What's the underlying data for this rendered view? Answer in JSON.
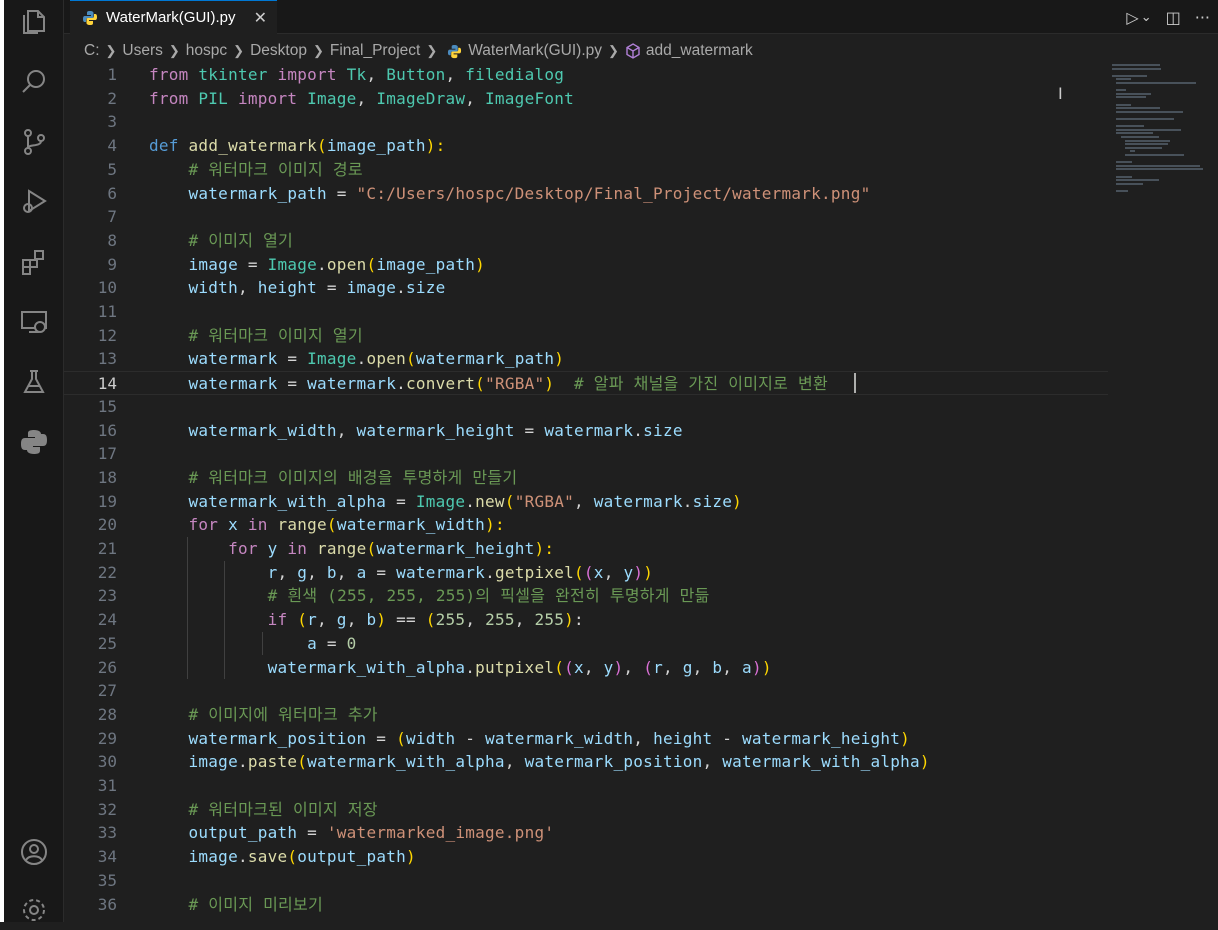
{
  "window": {
    "tab_title": "WaterMark(GUI).py",
    "tab_close": "✕",
    "run_button": "▷",
    "run_dropdown": "⌄",
    "split_button": "◫",
    "more_button": "···"
  },
  "breadcrumb": [
    "C:",
    "Users",
    "hospc",
    "Desktop",
    "Final_Project",
    "WaterMark(GUI).py",
    "add_watermark"
  ],
  "activity_bar": [
    "files-icon",
    "search-icon",
    "source-control-icon",
    "run-debug-icon",
    "extensions-icon",
    "remote-explorer-icon",
    "testing-icon",
    "python-icon",
    "account-icon",
    "settings-gear-icon"
  ],
  "editor": {
    "current_line": 14,
    "lines": [
      {
        "n": "1",
        "t": [
          [
            "from",
            "k"
          ],
          [
            " tkinter ",
            "c"
          ],
          [
            "import",
            "k"
          ],
          [
            " Tk",
            "c"
          ],
          [
            ", ",
            "o"
          ],
          [
            "Button",
            "c"
          ],
          [
            ", ",
            "o"
          ],
          [
            "filedialog",
            "c"
          ]
        ]
      },
      {
        "n": "2",
        "t": [
          [
            "from",
            "k"
          ],
          [
            " PIL ",
            "c"
          ],
          [
            "import",
            "k"
          ],
          [
            " Image",
            "c"
          ],
          [
            ", ",
            "o"
          ],
          [
            "ImageDraw",
            "c"
          ],
          [
            ", ",
            "o"
          ],
          [
            "ImageFont",
            "c"
          ]
        ]
      },
      {
        "n": "3",
        "t": []
      },
      {
        "n": "4",
        "t": [
          [
            "def",
            "d"
          ],
          [
            " ",
            "o"
          ],
          [
            "add_watermark",
            "f"
          ],
          [
            "(",
            "p1"
          ],
          [
            "image_path",
            "v"
          ],
          [
            "):",
            "p1"
          ]
        ]
      },
      {
        "n": "5",
        "t": [
          [
            "    ",
            "o"
          ],
          [
            "# 워터마크 이미지 경로",
            "m"
          ]
        ]
      },
      {
        "n": "6",
        "t": [
          [
            "    ",
            "o"
          ],
          [
            "watermark_path",
            "v"
          ],
          [
            " = ",
            "o"
          ],
          [
            "\"C:/Users/hospc/Desktop/Final_Project/watermark.png\"",
            "s"
          ]
        ]
      },
      {
        "n": "7",
        "t": []
      },
      {
        "n": "8",
        "t": [
          [
            "    ",
            "o"
          ],
          [
            "# 이미지 열기",
            "m"
          ]
        ]
      },
      {
        "n": "9",
        "t": [
          [
            "    ",
            "o"
          ],
          [
            "image",
            "v"
          ],
          [
            " = ",
            "o"
          ],
          [
            "Image",
            "c"
          ],
          [
            ".",
            "o"
          ],
          [
            "open",
            "f"
          ],
          [
            "(",
            "p1"
          ],
          [
            "image_path",
            "v"
          ],
          [
            ")",
            "p1"
          ]
        ]
      },
      {
        "n": "10",
        "t": [
          [
            "    ",
            "o"
          ],
          [
            "width",
            "v"
          ],
          [
            ", ",
            "o"
          ],
          [
            "height",
            "v"
          ],
          [
            " = ",
            "o"
          ],
          [
            "image",
            "v"
          ],
          [
            ".",
            "o"
          ],
          [
            "size",
            "v"
          ]
        ]
      },
      {
        "n": "11",
        "t": []
      },
      {
        "n": "12",
        "t": [
          [
            "    ",
            "o"
          ],
          [
            "# 워터마크 이미지 열기",
            "m"
          ]
        ]
      },
      {
        "n": "13",
        "t": [
          [
            "    ",
            "o"
          ],
          [
            "watermark",
            "v"
          ],
          [
            " = ",
            "o"
          ],
          [
            "Image",
            "c"
          ],
          [
            ".",
            "o"
          ],
          [
            "open",
            "f"
          ],
          [
            "(",
            "p1"
          ],
          [
            "watermark_path",
            "v"
          ],
          [
            ")",
            "p1"
          ]
        ]
      },
      {
        "n": "14",
        "t": [
          [
            "    ",
            "o"
          ],
          [
            "watermark",
            "v"
          ],
          [
            " = ",
            "o"
          ],
          [
            "watermark",
            "v"
          ],
          [
            ".",
            "o"
          ],
          [
            "convert",
            "f"
          ],
          [
            "(",
            "p1"
          ],
          [
            "\"RGBA\"",
            "s"
          ],
          [
            ")",
            "p1"
          ],
          [
            "  ",
            "o"
          ],
          [
            "# 알파 채널을 가진 이미지로 변환",
            "m"
          ]
        ]
      },
      {
        "n": "15",
        "t": []
      },
      {
        "n": "16",
        "t": [
          [
            "    ",
            "o"
          ],
          [
            "watermark_width",
            "v"
          ],
          [
            ", ",
            "o"
          ],
          [
            "watermark_height",
            "v"
          ],
          [
            " = ",
            "o"
          ],
          [
            "watermark",
            "v"
          ],
          [
            ".",
            "o"
          ],
          [
            "size",
            "v"
          ]
        ]
      },
      {
        "n": "17",
        "t": []
      },
      {
        "n": "18",
        "t": [
          [
            "    ",
            "o"
          ],
          [
            "# 워터마크 이미지의 배경을 투명하게 만들기",
            "m"
          ]
        ]
      },
      {
        "n": "19",
        "t": [
          [
            "    ",
            "o"
          ],
          [
            "watermark_with_alpha",
            "v"
          ],
          [
            " = ",
            "o"
          ],
          [
            "Image",
            "c"
          ],
          [
            ".",
            "o"
          ],
          [
            "new",
            "f"
          ],
          [
            "(",
            "p1"
          ],
          [
            "\"RGBA\"",
            "s"
          ],
          [
            ", ",
            "o"
          ],
          [
            "watermark",
            "v"
          ],
          [
            ".",
            "o"
          ],
          [
            "size",
            "v"
          ],
          [
            ")",
            "p1"
          ]
        ]
      },
      {
        "n": "20",
        "t": [
          [
            "    ",
            "o"
          ],
          [
            "for",
            "k"
          ],
          [
            " x ",
            "v"
          ],
          [
            "in",
            "k"
          ],
          [
            " ",
            "o"
          ],
          [
            "range",
            "f"
          ],
          [
            "(",
            "p1"
          ],
          [
            "watermark_width",
            "v"
          ],
          [
            "):",
            "p1"
          ]
        ]
      },
      {
        "n": "21",
        "t": [
          [
            "        ",
            "o"
          ],
          [
            "for",
            "k"
          ],
          [
            " y ",
            "v"
          ],
          [
            "in",
            "k"
          ],
          [
            " ",
            "o"
          ],
          [
            "range",
            "f"
          ],
          [
            "(",
            "p1"
          ],
          [
            "watermark_height",
            "v"
          ],
          [
            "):",
            "p1"
          ]
        ]
      },
      {
        "n": "22",
        "t": [
          [
            "            ",
            "o"
          ],
          [
            "r",
            "v"
          ],
          [
            ", ",
            "o"
          ],
          [
            "g",
            "v"
          ],
          [
            ", ",
            "o"
          ],
          [
            "b",
            "v"
          ],
          [
            ", ",
            "o"
          ],
          [
            "a",
            "v"
          ],
          [
            " = ",
            "o"
          ],
          [
            "watermark",
            "v"
          ],
          [
            ".",
            "o"
          ],
          [
            "getpixel",
            "f"
          ],
          [
            "(",
            "p1"
          ],
          [
            "(",
            "p2"
          ],
          [
            "x",
            "v"
          ],
          [
            ", ",
            "o"
          ],
          [
            "y",
            "v"
          ],
          [
            ")",
            "p2"
          ],
          [
            ")",
            "p1"
          ]
        ]
      },
      {
        "n": "23",
        "t": [
          [
            "            ",
            "o"
          ],
          [
            "# 흰색 (255, 255, 255)의 픽셀을 완전히 투명하게 만듦",
            "m"
          ]
        ]
      },
      {
        "n": "24",
        "t": [
          [
            "            ",
            "o"
          ],
          [
            "if",
            "k"
          ],
          [
            " ",
            "o"
          ],
          [
            "(",
            "p1"
          ],
          [
            "r",
            "v"
          ],
          [
            ", ",
            "o"
          ],
          [
            "g",
            "v"
          ],
          [
            ", ",
            "o"
          ],
          [
            "b",
            "v"
          ],
          [
            ")",
            "p1"
          ],
          [
            " == ",
            "o"
          ],
          [
            "(",
            "p1"
          ],
          [
            "255",
            "n"
          ],
          [
            ", ",
            "o"
          ],
          [
            "255",
            "n"
          ],
          [
            ", ",
            "o"
          ],
          [
            "255",
            "n"
          ],
          [
            ")",
            "p1"
          ],
          [
            ":",
            "o"
          ]
        ]
      },
      {
        "n": "25",
        "t": [
          [
            "                ",
            "o"
          ],
          [
            "a",
            "v"
          ],
          [
            " = ",
            "o"
          ],
          [
            "0",
            "n"
          ]
        ]
      },
      {
        "n": "26",
        "t": [
          [
            "            ",
            "o"
          ],
          [
            "watermark_with_alpha",
            "v"
          ],
          [
            ".",
            "o"
          ],
          [
            "putpixel",
            "f"
          ],
          [
            "(",
            "p1"
          ],
          [
            "(",
            "p2"
          ],
          [
            "x",
            "v"
          ],
          [
            ", ",
            "o"
          ],
          [
            "y",
            "v"
          ],
          [
            ")",
            "p2"
          ],
          [
            ", ",
            "o"
          ],
          [
            "(",
            "p2"
          ],
          [
            "r",
            "v"
          ],
          [
            ", ",
            "o"
          ],
          [
            "g",
            "v"
          ],
          [
            ", ",
            "o"
          ],
          [
            "b",
            "v"
          ],
          [
            ", ",
            "o"
          ],
          [
            "a",
            "v"
          ],
          [
            ")",
            "p2"
          ],
          [
            ")",
            "p1"
          ]
        ]
      },
      {
        "n": "27",
        "t": []
      },
      {
        "n": "28",
        "t": [
          [
            "    ",
            "o"
          ],
          [
            "# 이미지에 워터마크 추가",
            "m"
          ]
        ]
      },
      {
        "n": "29",
        "t": [
          [
            "    ",
            "o"
          ],
          [
            "watermark_position",
            "v"
          ],
          [
            " = ",
            "o"
          ],
          [
            "(",
            "p1"
          ],
          [
            "width",
            "v"
          ],
          [
            " - ",
            "o"
          ],
          [
            "watermark_width",
            "v"
          ],
          [
            ", ",
            "o"
          ],
          [
            "height",
            "v"
          ],
          [
            " - ",
            "o"
          ],
          [
            "watermark_height",
            "v"
          ],
          [
            ")",
            "p1"
          ]
        ]
      },
      {
        "n": "30",
        "t": [
          [
            "    ",
            "o"
          ],
          [
            "image",
            "v"
          ],
          [
            ".",
            "o"
          ],
          [
            "paste",
            "f"
          ],
          [
            "(",
            "p1"
          ],
          [
            "watermark_with_alpha",
            "v"
          ],
          [
            ", ",
            "o"
          ],
          [
            "watermark_position",
            "v"
          ],
          [
            ", ",
            "o"
          ],
          [
            "watermark_with_alpha",
            "v"
          ],
          [
            ")",
            "p1"
          ]
        ]
      },
      {
        "n": "31",
        "t": []
      },
      {
        "n": "32",
        "t": [
          [
            "    ",
            "o"
          ],
          [
            "# 워터마크된 이미지 저장",
            "m"
          ]
        ]
      },
      {
        "n": "33",
        "t": [
          [
            "    ",
            "o"
          ],
          [
            "output_path",
            "v"
          ],
          [
            " = ",
            "o"
          ],
          [
            "'watermarked_image.png'",
            "s"
          ]
        ]
      },
      {
        "n": "34",
        "t": [
          [
            "    ",
            "o"
          ],
          [
            "image",
            "v"
          ],
          [
            ".",
            "o"
          ],
          [
            "save",
            "f"
          ],
          [
            "(",
            "p1"
          ],
          [
            "output_path",
            "v"
          ],
          [
            ")",
            "p1"
          ]
        ]
      },
      {
        "n": "35",
        "t": []
      },
      {
        "n": "36",
        "t": [
          [
            "    ",
            "o"
          ],
          [
            "# 이미지 미리보기",
            "m"
          ]
        ]
      }
    ]
  }
}
